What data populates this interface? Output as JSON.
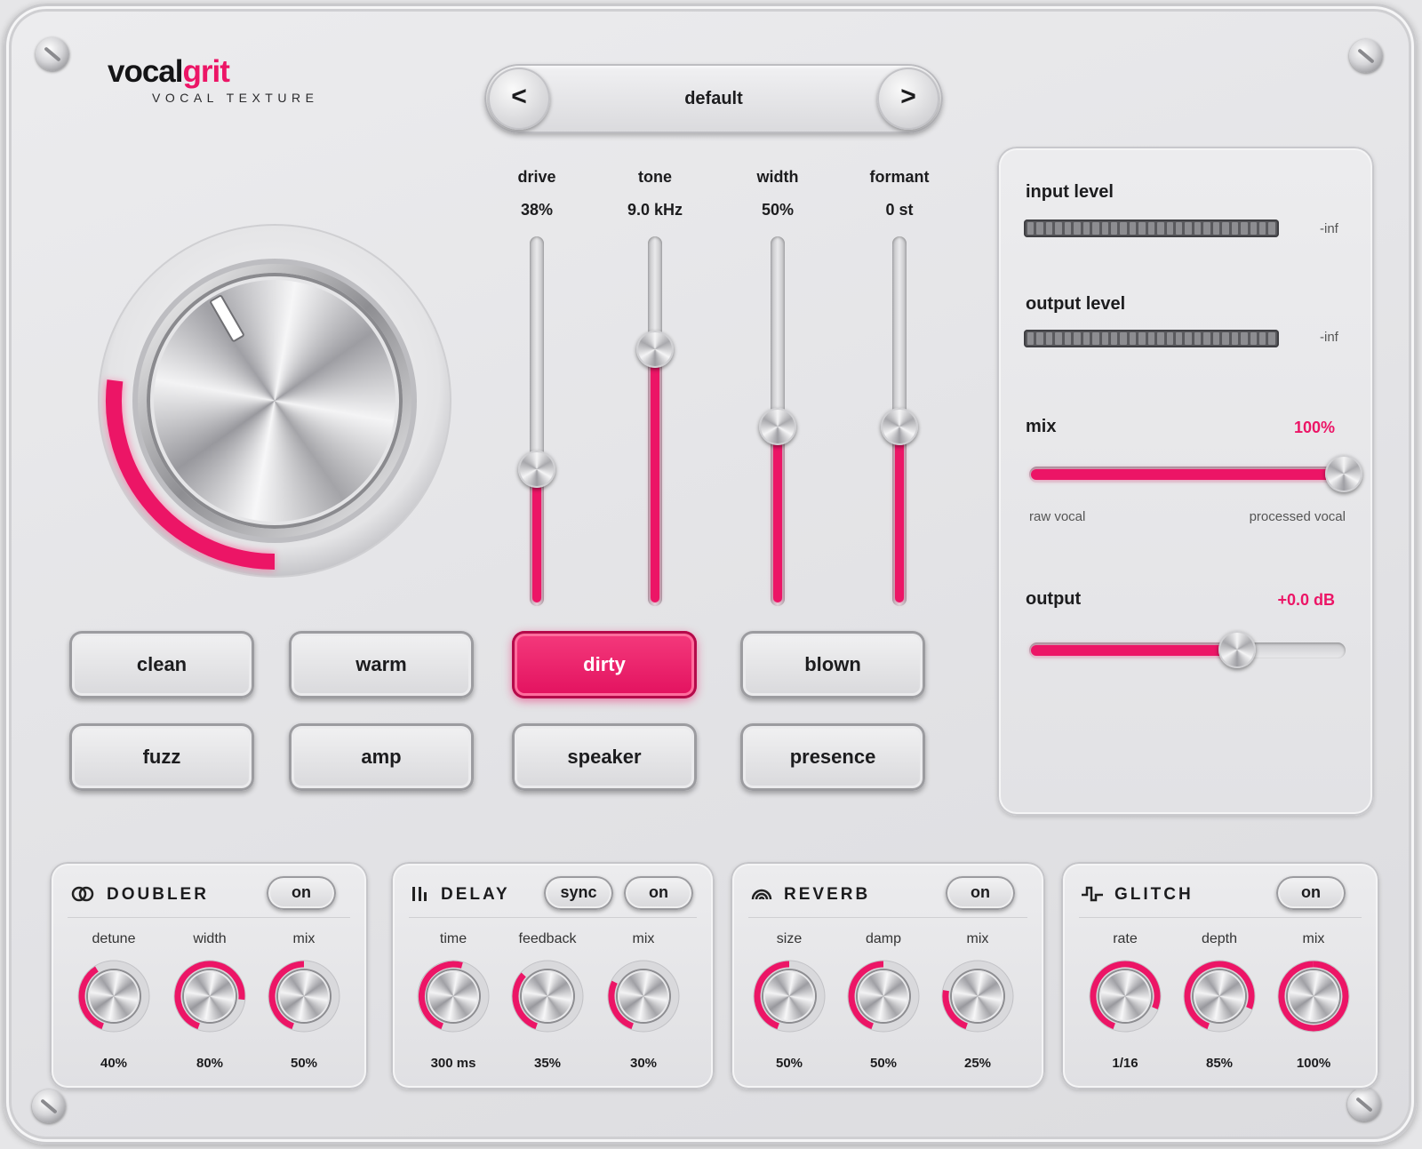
{
  "brand": {
    "name_part1": "vocal",
    "name_part2": "grit",
    "subtitle": "VOCAL TEXTURE",
    "accent_color": "#ec1566"
  },
  "preset": {
    "name": "default",
    "prev_label": "<",
    "next_label": ">"
  },
  "main_knob": {
    "value_fraction": 0.36,
    "icon": "large-drive-knob"
  },
  "faders": [
    {
      "label": "drive",
      "value": "38%",
      "fraction": 0.38
    },
    {
      "label": "tone",
      "value": "9.0 kHz",
      "fraction": 0.72
    },
    {
      "label": "width",
      "value": "50%",
      "fraction": 0.5
    },
    {
      "label": "formant",
      "value": "0 st",
      "fraction": 0.5
    }
  ],
  "modes": {
    "row1": [
      "clean",
      "warm",
      "dirty",
      "blown"
    ],
    "row2": [
      "fuzz",
      "amp",
      "speaker",
      "presence"
    ],
    "active": "dirty"
  },
  "side_panel": {
    "input_label": "input level",
    "input_value": "-inf",
    "output_meter_label": "output level",
    "output_meter_value": "-inf",
    "mix_label": "mix",
    "mix_value": "100%",
    "mix_fraction": 1.0,
    "mix_left": "raw vocal",
    "mix_right": "processed vocal",
    "output_label": "output",
    "output_value": "+0.0 dB",
    "output_fraction": 0.66
  },
  "modules": [
    {
      "id": "doubler",
      "title": "DOUBLER",
      "icon": "rings-icon",
      "buttons": [
        "on"
      ],
      "knobs": [
        {
          "label": "detune",
          "value": "40%",
          "fraction": 0.4
        },
        {
          "label": "width",
          "value": "80%",
          "fraction": 0.8
        },
        {
          "label": "mix",
          "value": "50%",
          "fraction": 0.5
        }
      ]
    },
    {
      "id": "delay",
      "title": "DELAY",
      "icon": "bars-icon",
      "buttons": [
        "sync",
        "on"
      ],
      "knobs": [
        {
          "label": "time",
          "value": "300 ms",
          "fraction": 0.55
        },
        {
          "label": "feedback",
          "value": "35%",
          "fraction": 0.35
        },
        {
          "label": "mix",
          "value": "30%",
          "fraction": 0.3
        }
      ]
    },
    {
      "id": "reverb",
      "title": "REVERB",
      "icon": "waves-icon",
      "buttons": [
        "on"
      ],
      "knobs": [
        {
          "label": "size",
          "value": "50%",
          "fraction": 0.5
        },
        {
          "label": "damp",
          "value": "50%",
          "fraction": 0.5
        },
        {
          "label": "mix",
          "value": "25%",
          "fraction": 0.25
        }
      ]
    },
    {
      "id": "glitch",
      "title": "GLITCH",
      "icon": "pulse-icon",
      "buttons": [
        "on"
      ],
      "knobs": [
        {
          "label": "rate",
          "value": "1/16",
          "fraction": 0.85
        },
        {
          "label": "depth",
          "value": "85%",
          "fraction": 0.85
        },
        {
          "label": "mix",
          "value": "100%",
          "fraction": 1.0
        }
      ]
    }
  ]
}
